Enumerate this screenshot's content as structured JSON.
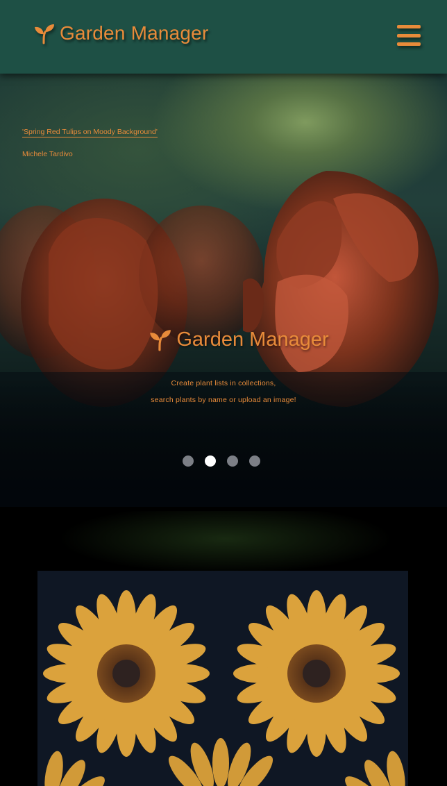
{
  "header": {
    "brand_icon": "sprout-icon",
    "title": "Garden Manager",
    "menu_icon": "hamburger-menu-icon"
  },
  "hero": {
    "image_credit_title": "'Spring Red Tulips on Moody Background'",
    "image_credit_author": "Michele Tardivo",
    "brand_icon": "sprout-icon",
    "title": "Garden Manager",
    "tagline_line1": "Create plant lists in collections,",
    "tagline_line2": "search plants by name or upload an image!",
    "carousel": {
      "slide_count": 4,
      "active_index": 1
    }
  },
  "colors": {
    "accent": "#e88b3a",
    "header_bg": "#1e5045",
    "page_bg": "#000000",
    "card_bg": "#0f1724",
    "dot_inactive": "#7c7f86",
    "dot_active": "#ffffff"
  }
}
